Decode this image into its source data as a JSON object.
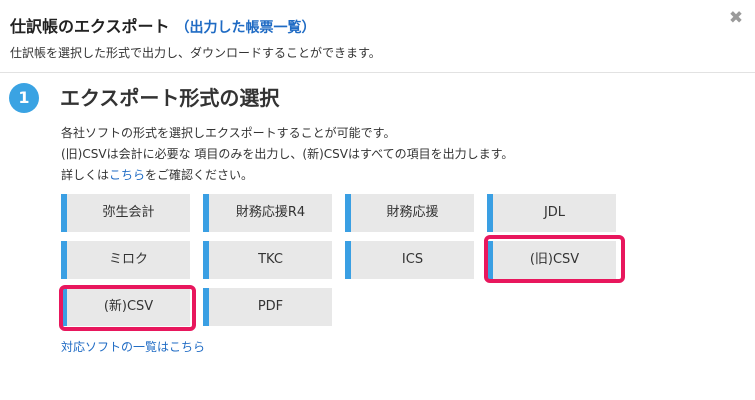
{
  "header": {
    "title": "仕訳帳のエクスポート",
    "title_link": "（出力した帳票一覧）",
    "subtitle": "仕訳帳を選択した形式で出力し、ダウンロードすることができます。",
    "close_glyph": "✖"
  },
  "step": {
    "number": "1",
    "title": "エクスポート形式の選択"
  },
  "description": {
    "line1": "各社ソフトの形式を選択しエクスポートすることが可能です。",
    "line2": "(旧)CSVは会計に必要な 項目のみを出力し、(新)CSVはすべての項目を出力します。",
    "line3_prefix": "詳しくは",
    "line3_link": "こちら",
    "line3_suffix": "をご確認ください。"
  },
  "formats": [
    "弥生会計",
    "財務応援R4",
    "財務応援",
    "JDL",
    "ミロク",
    "TKC",
    "ICS",
    "(旧)CSV",
    "(新)CSV",
    "PDF"
  ],
  "footer_link": "対応ソフトの一覧はこちら",
  "colors": {
    "accent": "#3a9fe3",
    "highlight": "#e8175d",
    "link": "#1f6bc4"
  }
}
